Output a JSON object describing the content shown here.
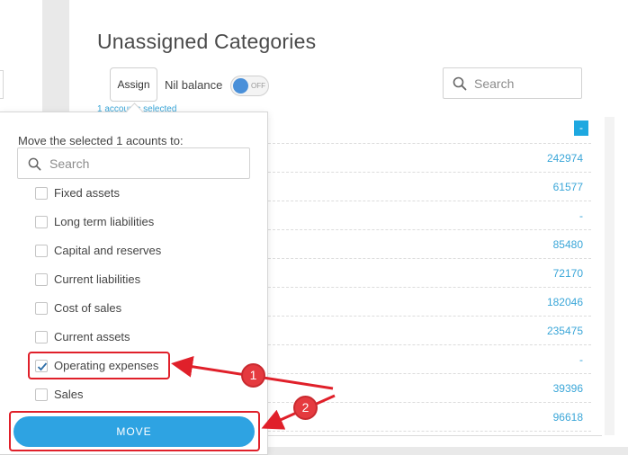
{
  "header": {
    "title": "Unassigned Categories",
    "assign_label": "Assign",
    "nil_balance_label": "Nil balance",
    "toggle_state": "OFF",
    "selected_text": "1 accounts selected",
    "search_placeholder": "Search"
  },
  "values": [
    {
      "text": "-",
      "badge": true
    },
    {
      "text": "242974"
    },
    {
      "text": "61577"
    },
    {
      "text": "-"
    },
    {
      "text": "85480"
    },
    {
      "text": "72170"
    },
    {
      "text": "182046"
    },
    {
      "text": "235475"
    },
    {
      "text": "-"
    },
    {
      "text": "39396"
    },
    {
      "text": "96618"
    }
  ],
  "popup": {
    "title": "Move the selected 1 acounts to:",
    "search_placeholder": "Search",
    "categories": [
      {
        "label": "Fixed assets",
        "checked": false
      },
      {
        "label": "Long term liabilities",
        "checked": false
      },
      {
        "label": "Capital and reserves",
        "checked": false
      },
      {
        "label": "Current liabilities",
        "checked": false
      },
      {
        "label": "Cost of sales",
        "checked": false
      },
      {
        "label": "Current assets",
        "checked": false
      },
      {
        "label": "Operating expenses",
        "checked": true
      },
      {
        "label": "Sales",
        "checked": false
      }
    ],
    "move_label": "MOVE"
  },
  "annotations": {
    "step_1": "1",
    "step_2": "2",
    "highlight_color": "#e0202a"
  },
  "colors": {
    "accent": "#2ea3e2",
    "value_text": "#3aa6d8",
    "toggle_knob": "#4a90d9"
  }
}
